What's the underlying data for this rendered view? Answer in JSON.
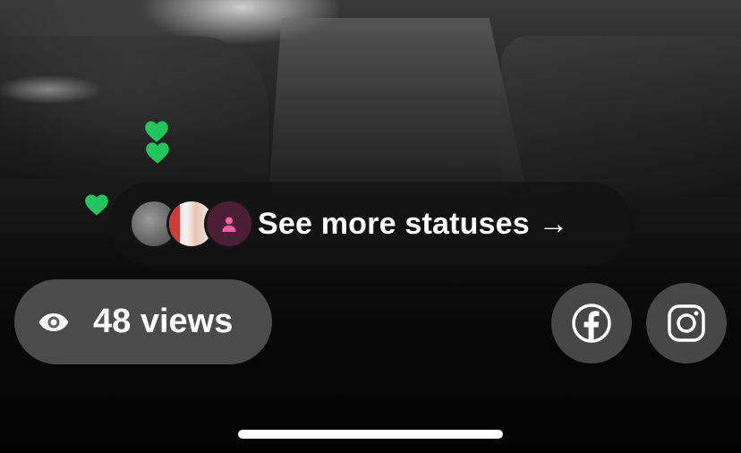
{
  "statuses": {
    "label": "See more statuses →"
  },
  "views": {
    "label": "48 views"
  },
  "avatars": [
    {
      "name": "avatar-photo-grey"
    },
    {
      "name": "avatar-photo-portrait"
    },
    {
      "name": "avatar-placeholder"
    }
  ],
  "icons": {
    "views": "eye-icon",
    "facebook": "facebook-icon",
    "instagram": "instagram-icon",
    "reaction": "green-heart-icon",
    "placeholder": "person-icon"
  },
  "colors": {
    "heart": "#22c55e",
    "placeholder_person": "#ff5fa2",
    "pill_dark": "#121212",
    "pill_grey": "#5f5f5f"
  }
}
